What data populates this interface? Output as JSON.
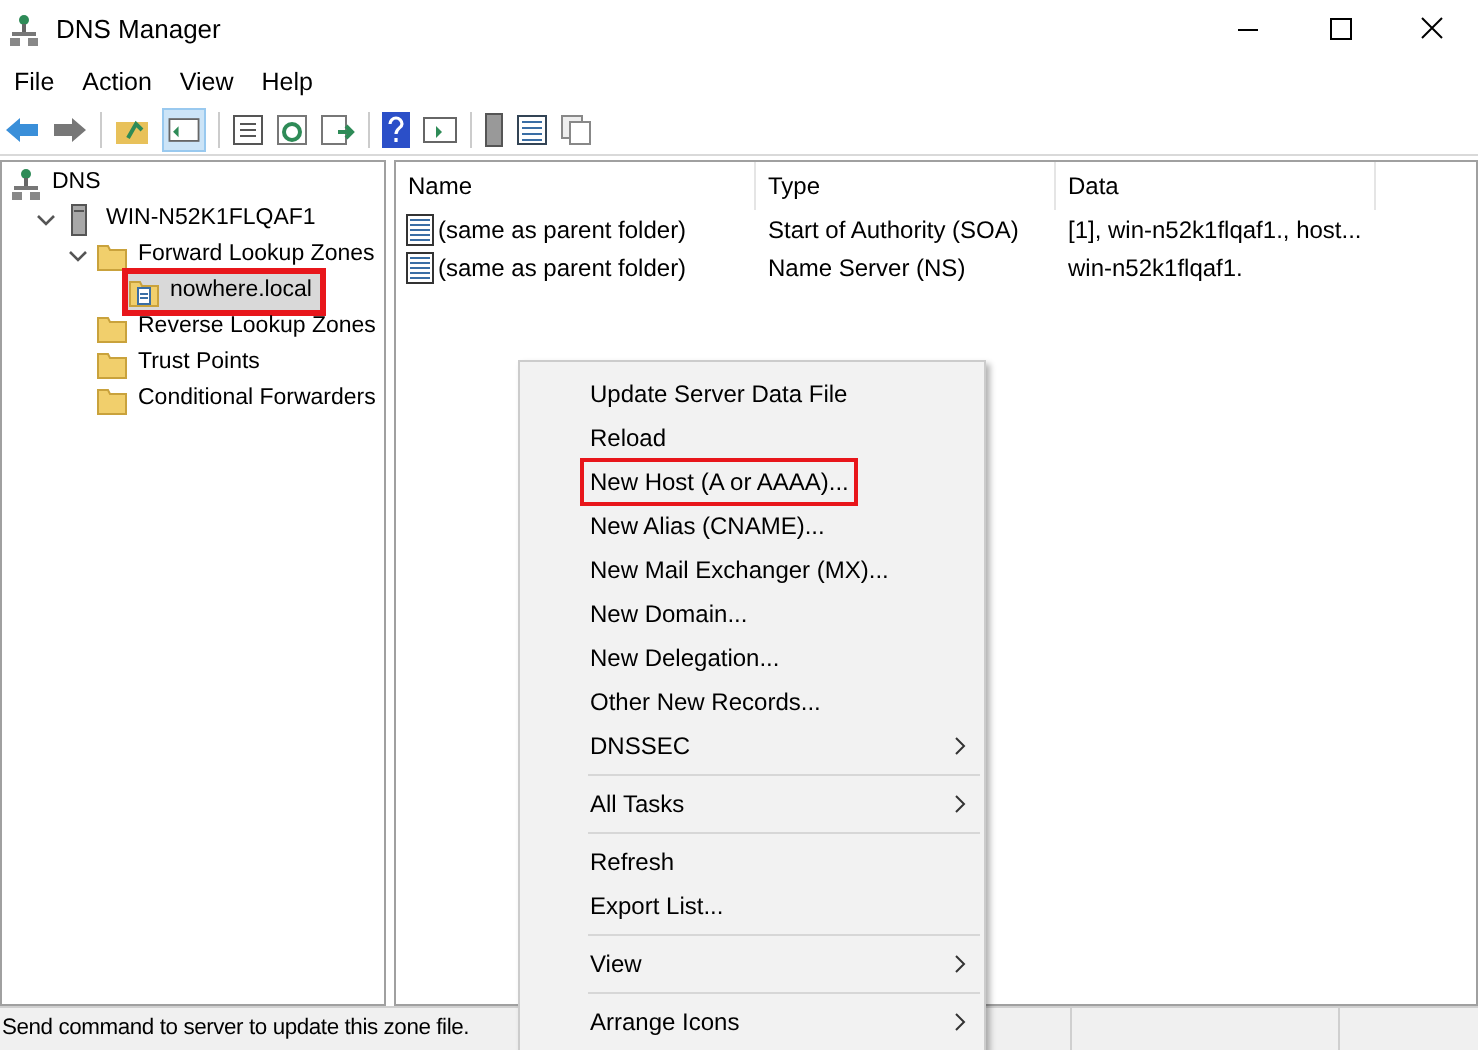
{
  "window": {
    "title": "DNS Manager"
  },
  "menu_bar": [
    "File",
    "Action",
    "View",
    "Help"
  ],
  "tree": [
    {
      "label": "DNS",
      "kind": "dns",
      "selected": false,
      "highlighted": false,
      "children": [
        {
          "label": "WIN-N52K1FLQAF1",
          "kind": "server",
          "expanded": true,
          "selected": false,
          "highlighted": false,
          "children": [
            {
              "label": "Forward Lookup Zones",
              "kind": "folder",
              "expanded": true,
              "selected": false,
              "highlighted": false,
              "children": [
                {
                  "label": "nowhere.local",
                  "kind": "zone",
                  "selected": true,
                  "highlighted": true
                }
              ]
            },
            {
              "label": "Reverse Lookup Zones",
              "kind": "folder",
              "selected": false,
              "highlighted": false
            },
            {
              "label": "Trust Points",
              "kind": "folder",
              "selected": false,
              "highlighted": false
            },
            {
              "label": "Conditional Forwarders",
              "kind": "folder",
              "selected": false,
              "highlighted": false
            }
          ]
        }
      ]
    }
  ],
  "table": {
    "columns": [
      "Name",
      "Type",
      "Data"
    ],
    "rows": [
      {
        "name": "(same as parent folder)",
        "type": "Start of Authority (SOA)",
        "data": "[1], win-n52k1flqaf1., host..."
      },
      {
        "name": "(same as parent folder)",
        "type": "Name Server (NS)",
        "data": "win-n52k1flqaf1."
      }
    ]
  },
  "context_menu": [
    [
      {
        "label": "Update Server Data File",
        "submenu": false,
        "highlighted": false
      },
      {
        "label": "Reload",
        "submenu": false,
        "highlighted": false
      },
      {
        "label": "New Host (A or AAAA)...",
        "submenu": false,
        "highlighted": true
      },
      {
        "label": "New Alias (CNAME)...",
        "submenu": false,
        "highlighted": false
      },
      {
        "label": "New Mail Exchanger (MX)...",
        "submenu": false,
        "highlighted": false
      },
      {
        "label": "New Domain...",
        "submenu": false,
        "highlighted": false
      },
      {
        "label": "New Delegation...",
        "submenu": false,
        "highlighted": false
      },
      {
        "label": "Other New Records...",
        "submenu": false,
        "highlighted": false
      },
      {
        "label": "DNSSEC",
        "submenu": true,
        "highlighted": false
      }
    ],
    [
      {
        "label": "All Tasks",
        "submenu": true,
        "highlighted": false
      }
    ],
    [
      {
        "label": "Refresh",
        "submenu": false,
        "highlighted": false
      },
      {
        "label": "Export List...",
        "submenu": false,
        "highlighted": false
      }
    ],
    [
      {
        "label": "View",
        "submenu": true,
        "highlighted": false
      }
    ],
    [
      {
        "label": "Arrange Icons",
        "submenu": true,
        "highlighted": false
      }
    ]
  ],
  "status_bar": "Send command to server to update this zone file."
}
